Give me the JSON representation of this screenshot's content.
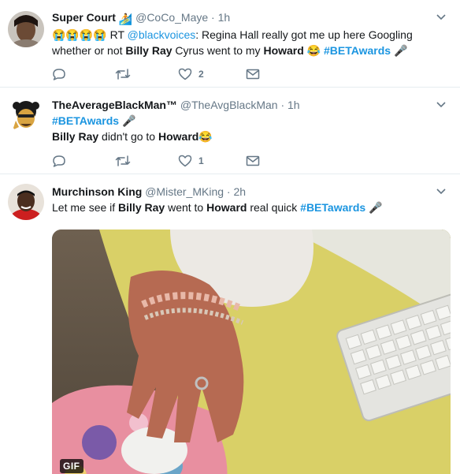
{
  "tweets": [
    {
      "name": "Super Court",
      "handle": "@CoCo_Maye",
      "separator": "·",
      "time": "1h",
      "name_emoji": "🏄",
      "text_parts": {
        "p1": "😭😭😭😭 RT ",
        "mention": "@blackvoices",
        "p2": ": Regina Hall really got me up here Googling whether or not ",
        "b1": "Billy Ray",
        "p3": " Cyrus went to my ",
        "b2": "Howard",
        "p4": " 😂 ",
        "hashtag": "#BETAwards",
        "p5": " 🎤"
      },
      "likes": "2"
    },
    {
      "name": "TheAverageBlackMan™",
      "handle": "@TheAvgBlackMan",
      "separator": "·",
      "time": "1h",
      "text_parts": {
        "hashtag": "#BETAwards",
        "p1": " 🎤",
        "b1": "Billy Ray",
        "p2": " didn't go to ",
        "b2": "Howard",
        "p3": "😂"
      },
      "likes": "1"
    },
    {
      "name": "Murchinson King",
      "handle": "@Mister_MKing",
      "separator": "·",
      "time": "2h",
      "text_parts": {
        "p1": "Let me see if ",
        "b1": "Billy Ray",
        "p2": " went to ",
        "b2": "Howard",
        "p3": " real quick ",
        "hashtag": "#BETawards",
        "p4": " 🎤"
      },
      "media_badge": "GIF"
    }
  ],
  "icons": {
    "reply": "reply-icon",
    "retweet": "retweet-icon",
    "like": "heart-icon",
    "dm": "envelope-icon",
    "caret": "chevron-down-icon"
  },
  "colors": {
    "link": "#1b95e0",
    "muted": "#657786",
    "text": "#14171a"
  }
}
